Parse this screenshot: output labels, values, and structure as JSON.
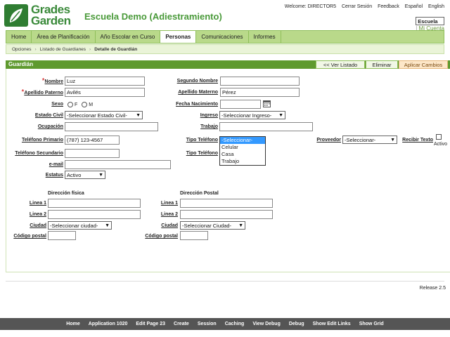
{
  "header": {
    "logo_line1": "Grades",
    "logo_line2": "Garden",
    "app_title": "Escuela Demo (Adiestramiento)",
    "welcome": "Welcome: DIRECTOR5",
    "logout": "Cerrar Sesión",
    "feedback": "Feedback",
    "lang_es": "Español",
    "lang_en": "English",
    "context_current": "Escuela",
    "context_other": "Mi Cuenta"
  },
  "tabs": [
    {
      "label": "Home"
    },
    {
      "label": "Área de Planificación"
    },
    {
      "label": "Año Escolar en Curso"
    },
    {
      "label": "Personas",
      "active": true
    },
    {
      "label": "Comunicaciones"
    },
    {
      "label": "Informes"
    }
  ],
  "breadcrumb": [
    "Opciones",
    "Listado de Guardianes",
    "Detalle de Guardián"
  ],
  "region": {
    "title": "Guardián",
    "btn_list": "<< Ver Listado",
    "btn_delete": "Eliminar",
    "btn_apply": "Aplicar Cambios"
  },
  "form": {
    "nombre_label": "Nombre",
    "nombre_value": "Luz",
    "segundo_label": "Segundo Nombre",
    "segundo_value": "",
    "ap_paterno_label": "Apellido Paterno",
    "ap_paterno_value": "Avilés",
    "ap_materno_label": "Apellido Materno",
    "ap_materno_value": "Pérez",
    "sexo_label": "Sexo",
    "sexo_f": "F",
    "sexo_m": "M",
    "fecha_label": "Fecha Nacimiento",
    "fecha_value": "",
    "civil_label": "Estado Civil",
    "civil_value": "-Seleccionar Estado Civil-",
    "ingreso_label": "Ingreso",
    "ingreso_value": "-Seleccionar Ingreso-",
    "ocupacion_label": "Ocupación",
    "ocupacion_value": "",
    "trabajo_label": "Trabajo",
    "trabajo_value": "",
    "tel1_label": "Teléfono Primario",
    "tel1_value": "(787) 123-4567",
    "tipo1_label": "Tipo Teléfono",
    "tipo_options": [
      "-Seleccionar-",
      "Celular",
      "Casa",
      "Trabajo"
    ],
    "proveedor_label": "Proveedor",
    "proveedor_value": "-Seleccionar-",
    "recibir_label": "Recibir Texto",
    "activo_label": "Activo",
    "tel2_label": "Teléfono Secundario",
    "tel2_value": "",
    "tipo2_label": "Tipo Teléfono",
    "email_label": "e-mail",
    "email_value": "",
    "estatus_label": "Estatus",
    "estatus_value": "Activo"
  },
  "fisica": {
    "heading": "Dirección física",
    "linea1_label": "Linea 1",
    "linea1_value": "",
    "linea2_label": "Linea 2",
    "linea2_value": "",
    "ciudad_label": "Ciudad",
    "ciudad_value": "-Seleccionar ciudad-",
    "postal_label": "Código postal",
    "postal_value": ""
  },
  "postal": {
    "heading": "Dirección Postal",
    "linea1_label": "Linea 1",
    "linea1_value": "",
    "linea2_label": "Linea 2",
    "linea2_value": "",
    "ciudad_label": "Ciudad",
    "ciudad_value": "-Seleccionar Ciudad-",
    "postal_label": "Código postal",
    "postal_value": ""
  },
  "release": "Release 2.5",
  "devbar": [
    "Home",
    "Application 1020",
    "Edit Page 23",
    "Create",
    "Session",
    "Caching",
    "View Debug",
    "Debug",
    "Show Edit Links",
    "Show Grid"
  ]
}
